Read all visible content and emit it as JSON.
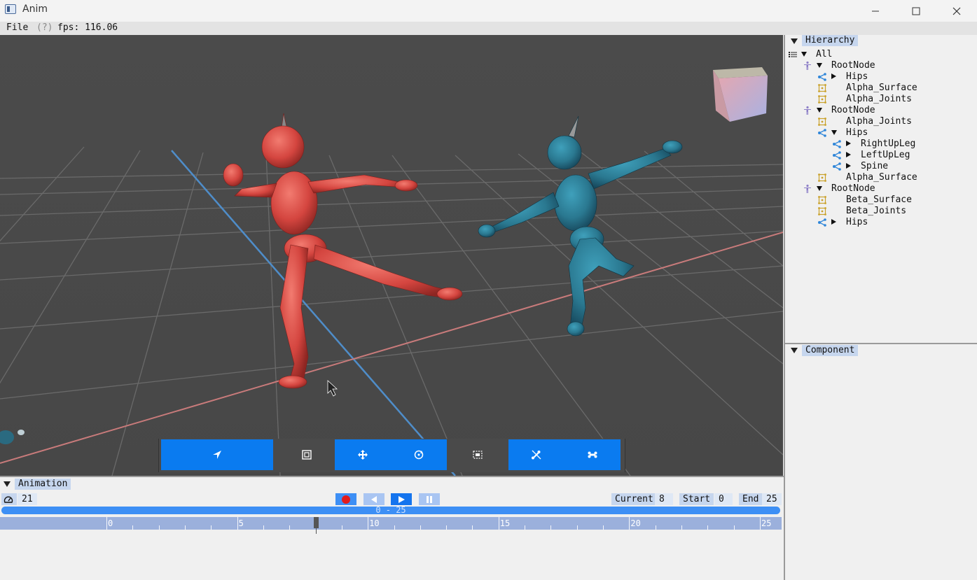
{
  "window": {
    "title": "Anim",
    "minimize_icon": "minimize-icon",
    "maximize_icon": "maximize-icon",
    "close_icon": "close-icon"
  },
  "menu": {
    "file": "File",
    "help": "(?)",
    "fps": "fps: 116.06"
  },
  "colors": {
    "accent": "#0a7bf0",
    "tab_highlight": "#c6d6ee",
    "timeline": "#9bb0dc",
    "range_bar": "#3d8ff5",
    "character_red": "#d4453f",
    "character_teal": "#2d7f98",
    "viewport_bg": "#4a4a4a"
  },
  "viewport_toolbar": [
    {
      "name": "select-tool-button",
      "icon": "navigation-arrow-icon"
    },
    {
      "name": "frame-tool-button",
      "icon": "frame-select-icon"
    },
    {
      "name": "move-tool-button",
      "icon": "move-arrows-icon"
    },
    {
      "name": "rotate-tool-button",
      "icon": "rotate-icon"
    },
    {
      "name": "box-select-button",
      "icon": "box-select-icon"
    },
    {
      "name": "bone-toggle-button",
      "icon": "bone-off-icon"
    },
    {
      "name": "bone-button",
      "icon": "bone-icon"
    }
  ],
  "hierarchy": {
    "title": "Hierarchy",
    "items": [
      {
        "label": "All",
        "icon": "list-icon",
        "depth": 0,
        "toggle": "expanded"
      },
      {
        "label": "RootNode",
        "icon": "figure-icon",
        "depth": 1,
        "toggle": "expanded"
      },
      {
        "label": "Hips",
        "icon": "share-node-icon",
        "depth": 2,
        "toggle": "collapsed"
      },
      {
        "label": "Alpha_Surface",
        "icon": "mesh-icon",
        "depth": 2,
        "toggle": "none"
      },
      {
        "label": "Alpha_Joints",
        "icon": "mesh-icon",
        "depth": 2,
        "toggle": "none"
      },
      {
        "label": "RootNode",
        "icon": "figure-icon",
        "depth": 1,
        "toggle": "expanded"
      },
      {
        "label": "Alpha_Joints",
        "icon": "mesh-icon",
        "depth": 2,
        "toggle": "none"
      },
      {
        "label": "Hips",
        "icon": "share-node-icon",
        "depth": 2,
        "toggle": "expanded"
      },
      {
        "label": "RightUpLeg",
        "icon": "share-node-icon",
        "depth": 3,
        "toggle": "collapsed"
      },
      {
        "label": "LeftUpLeg",
        "icon": "share-node-icon",
        "depth": 3,
        "toggle": "collapsed"
      },
      {
        "label": "Spine",
        "icon": "share-node-icon",
        "depth": 3,
        "toggle": "collapsed"
      },
      {
        "label": "Alpha_Surface",
        "icon": "mesh-icon",
        "depth": 2,
        "toggle": "none"
      },
      {
        "label": "RootNode",
        "icon": "figure-icon",
        "depth": 1,
        "toggle": "expanded"
      },
      {
        "label": "Beta_Surface",
        "icon": "mesh-icon",
        "depth": 2,
        "toggle": "none"
      },
      {
        "label": "Beta_Joints",
        "icon": "mesh-icon",
        "depth": 2,
        "toggle": "none"
      },
      {
        "label": "Hips",
        "icon": "share-node-icon",
        "depth": 2,
        "toggle": "collapsed"
      }
    ]
  },
  "component": {
    "title": "Component"
  },
  "animation": {
    "title": "Animation",
    "speed_icon": "speedometer-icon",
    "fps_value": "21",
    "record_icon": "record-icon",
    "prev_icon": "step-back-icon",
    "play_icon": "play-icon",
    "pause_icon": "pause-icon",
    "current_label": "Current",
    "current_value": "8",
    "start_label": "Start",
    "start_value": "0",
    "end_label": "End",
    "end_value": "25",
    "range_text": "0 - 25",
    "timeline_start": 0,
    "timeline_end": 25,
    "timeline_labels": [
      "0",
      "5",
      "10",
      "15",
      "20",
      "25"
    ],
    "playhead_frame": 8
  }
}
